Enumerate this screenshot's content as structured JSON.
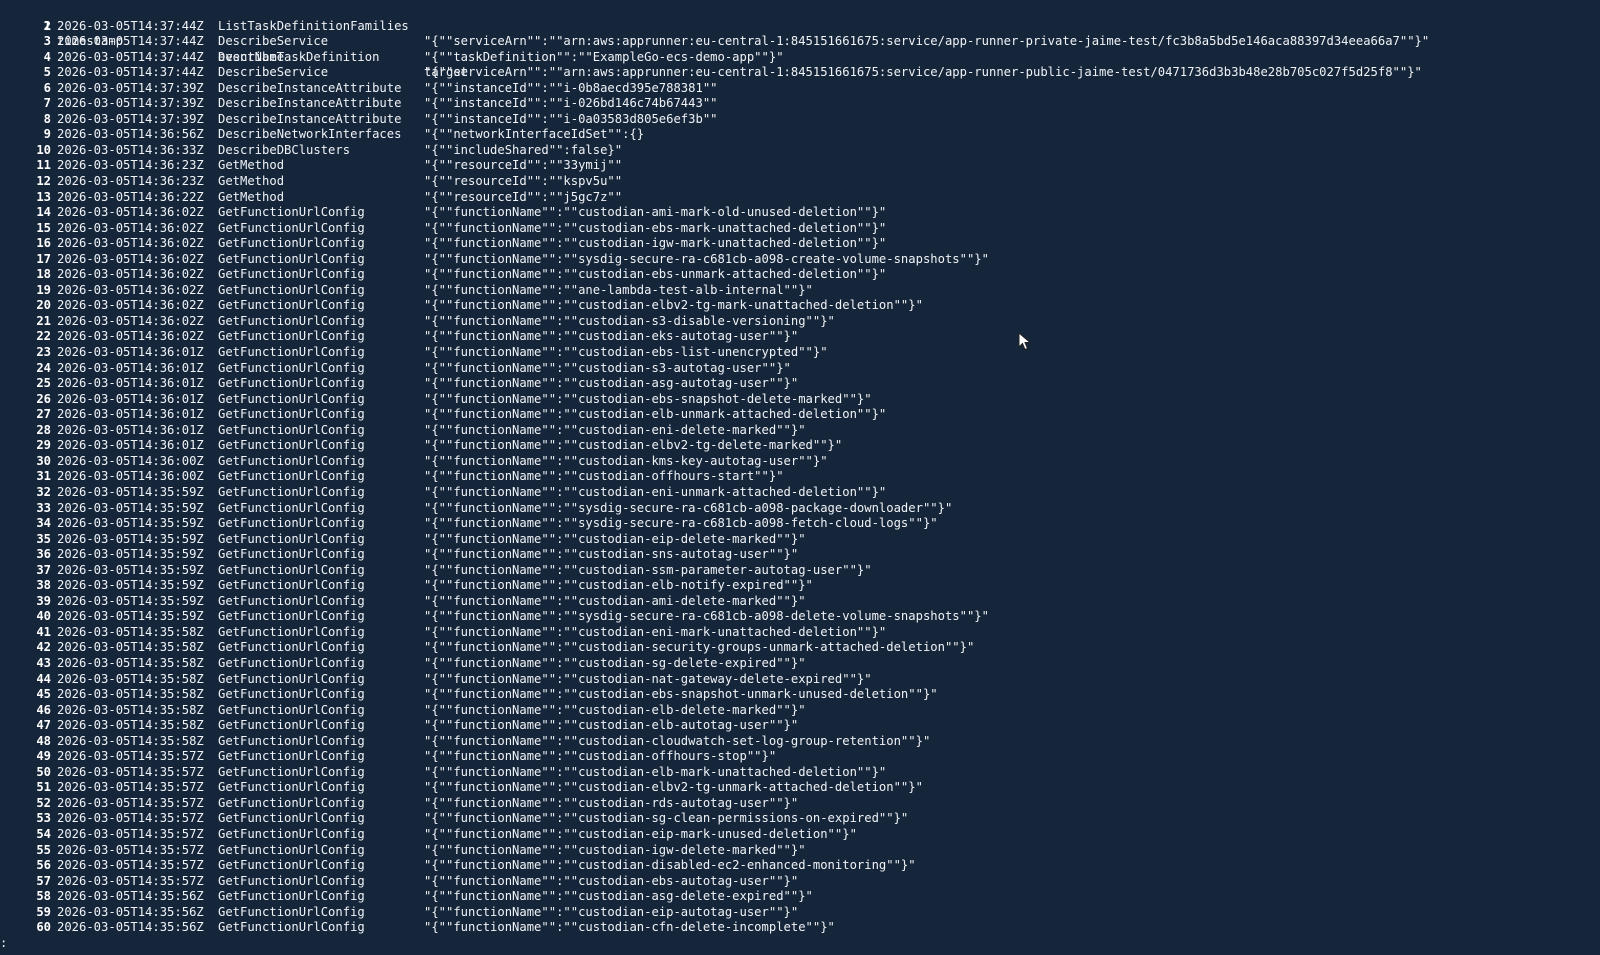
{
  "header": {
    "num": "1",
    "c1": "timestamp",
    "c2": "eventName",
    "c3": "target"
  },
  "rows": [
    {
      "num": "2",
      "ts": "2026-03-05T14:37:44Z",
      "ev": "ListTaskDefinitionFamilies",
      "tg": ""
    },
    {
      "num": "3",
      "ts": "2026-03-05T14:37:44Z",
      "ev": "DescribeService",
      "tg": "\"{\"\"serviceArn\"\":\"\"arn:aws:apprunner:eu-central-1:845151661675:service/app-runner-private-jaime-test/fc3b8a5bd5e146aca88397d34eea66a7\"\"}\""
    },
    {
      "num": "4",
      "ts": "2026-03-05T14:37:44Z",
      "ev": "DescribeTaskDefinition",
      "tg": "\"{\"\"taskDefinition\"\":\"\"ExampleGo-ecs-demo-app\"\"}\""
    },
    {
      "num": "5",
      "ts": "2026-03-05T14:37:44Z",
      "ev": "DescribeService",
      "tg": "\"{\"\"serviceArn\"\":\"\"arn:aws:apprunner:eu-central-1:845151661675:service/app-runner-public-jaime-test/0471736d3b3b48e28b705c027f5d25f8\"\"}\""
    },
    {
      "num": "6",
      "ts": "2026-03-05T14:37:39Z",
      "ev": "DescribeInstanceAttribute",
      "tg": "\"{\"\"instanceId\"\":\"\"i-0b8aecd395e788381\"\""
    },
    {
      "num": "7",
      "ts": "2026-03-05T14:37:39Z",
      "ev": "DescribeInstanceAttribute",
      "tg": "\"{\"\"instanceId\"\":\"\"i-026bd146c74b67443\"\""
    },
    {
      "num": "8",
      "ts": "2026-03-05T14:37:39Z",
      "ev": "DescribeInstanceAttribute",
      "tg": "\"{\"\"instanceId\"\":\"\"i-0a03583d805e6ef3b\"\""
    },
    {
      "num": "9",
      "ts": "2026-03-05T14:36:56Z",
      "ev": "DescribeNetworkInterfaces",
      "tg": "\"{\"\"networkInterfaceIdSet\"\":{}"
    },
    {
      "num": "10",
      "ts": "2026-03-05T14:36:33Z",
      "ev": "DescribeDBClusters",
      "tg": "\"{\"\"includeShared\"\":false}\""
    },
    {
      "num": "11",
      "ts": "2026-03-05T14:36:23Z",
      "ev": "GetMethod",
      "tg": "\"{\"\"resourceId\"\":\"\"33ymij\"\""
    },
    {
      "num": "12",
      "ts": "2026-03-05T14:36:23Z",
      "ev": "GetMethod",
      "tg": "\"{\"\"resourceId\"\":\"\"kspv5u\"\""
    },
    {
      "num": "13",
      "ts": "2026-03-05T14:36:22Z",
      "ev": "GetMethod",
      "tg": "\"{\"\"resourceId\"\":\"\"j5gc7z\"\""
    },
    {
      "num": "14",
      "ts": "2026-03-05T14:36:02Z",
      "ev": "GetFunctionUrlConfig",
      "tg": "\"{\"\"functionName\"\":\"\"custodian-ami-mark-old-unused-deletion\"\"}\""
    },
    {
      "num": "15",
      "ts": "2026-03-05T14:36:02Z",
      "ev": "GetFunctionUrlConfig",
      "tg": "\"{\"\"functionName\"\":\"\"custodian-ebs-mark-unattached-deletion\"\"}\""
    },
    {
      "num": "16",
      "ts": "2026-03-05T14:36:02Z",
      "ev": "GetFunctionUrlConfig",
      "tg": "\"{\"\"functionName\"\":\"\"custodian-igw-mark-unattached-deletion\"\"}\""
    },
    {
      "num": "17",
      "ts": "2026-03-05T14:36:02Z",
      "ev": "GetFunctionUrlConfig",
      "tg": "\"{\"\"functionName\"\":\"\"sysdig-secure-ra-c681cb-a098-create-volume-snapshots\"\"}\""
    },
    {
      "num": "18",
      "ts": "2026-03-05T14:36:02Z",
      "ev": "GetFunctionUrlConfig",
      "tg": "\"{\"\"functionName\"\":\"\"custodian-ebs-unmark-attached-deletion\"\"}\""
    },
    {
      "num": "19",
      "ts": "2026-03-05T14:36:02Z",
      "ev": "GetFunctionUrlConfig",
      "tg": "\"{\"\"functionName\"\":\"\"ane-lambda-test-alb-internal\"\"}\""
    },
    {
      "num": "20",
      "ts": "2026-03-05T14:36:02Z",
      "ev": "GetFunctionUrlConfig",
      "tg": "\"{\"\"functionName\"\":\"\"custodian-elbv2-tg-mark-unattached-deletion\"\"}\""
    },
    {
      "num": "21",
      "ts": "2026-03-05T14:36:02Z",
      "ev": "GetFunctionUrlConfig",
      "tg": "\"{\"\"functionName\"\":\"\"custodian-s3-disable-versioning\"\"}\""
    },
    {
      "num": "22",
      "ts": "2026-03-05T14:36:02Z",
      "ev": "GetFunctionUrlConfig",
      "tg": "\"{\"\"functionName\"\":\"\"custodian-eks-autotag-user\"\"}\""
    },
    {
      "num": "23",
      "ts": "2026-03-05T14:36:01Z",
      "ev": "GetFunctionUrlConfig",
      "tg": "\"{\"\"functionName\"\":\"\"custodian-ebs-list-unencrypted\"\"}\""
    },
    {
      "num": "24",
      "ts": "2026-03-05T14:36:01Z",
      "ev": "GetFunctionUrlConfig",
      "tg": "\"{\"\"functionName\"\":\"\"custodian-s3-autotag-user\"\"}\""
    },
    {
      "num": "25",
      "ts": "2026-03-05T14:36:01Z",
      "ev": "GetFunctionUrlConfig",
      "tg": "\"{\"\"functionName\"\":\"\"custodian-asg-autotag-user\"\"}\""
    },
    {
      "num": "26",
      "ts": "2026-03-05T14:36:01Z",
      "ev": "GetFunctionUrlConfig",
      "tg": "\"{\"\"functionName\"\":\"\"custodian-ebs-snapshot-delete-marked\"\"}\""
    },
    {
      "num": "27",
      "ts": "2026-03-05T14:36:01Z",
      "ev": "GetFunctionUrlConfig",
      "tg": "\"{\"\"functionName\"\":\"\"custodian-elb-unmark-attached-deletion\"\"}\""
    },
    {
      "num": "28",
      "ts": "2026-03-05T14:36:01Z",
      "ev": "GetFunctionUrlConfig",
      "tg": "\"{\"\"functionName\"\":\"\"custodian-eni-delete-marked\"\"}\""
    },
    {
      "num": "29",
      "ts": "2026-03-05T14:36:01Z",
      "ev": "GetFunctionUrlConfig",
      "tg": "\"{\"\"functionName\"\":\"\"custodian-elbv2-tg-delete-marked\"\"}\""
    },
    {
      "num": "30",
      "ts": "2026-03-05T14:36:00Z",
      "ev": "GetFunctionUrlConfig",
      "tg": "\"{\"\"functionName\"\":\"\"custodian-kms-key-autotag-user\"\"}\""
    },
    {
      "num": "31",
      "ts": "2026-03-05T14:36:00Z",
      "ev": "GetFunctionUrlConfig",
      "tg": "\"{\"\"functionName\"\":\"\"custodian-offhours-start\"\"}\""
    },
    {
      "num": "32",
      "ts": "2026-03-05T14:35:59Z",
      "ev": "GetFunctionUrlConfig",
      "tg": "\"{\"\"functionName\"\":\"\"custodian-eni-unmark-attached-deletion\"\"}\""
    },
    {
      "num": "33",
      "ts": "2026-03-05T14:35:59Z",
      "ev": "GetFunctionUrlConfig",
      "tg": "\"{\"\"functionName\"\":\"\"sysdig-secure-ra-c681cb-a098-package-downloader\"\"}\""
    },
    {
      "num": "34",
      "ts": "2026-03-05T14:35:59Z",
      "ev": "GetFunctionUrlConfig",
      "tg": "\"{\"\"functionName\"\":\"\"sysdig-secure-ra-c681cb-a098-fetch-cloud-logs\"\"}\""
    },
    {
      "num": "35",
      "ts": "2026-03-05T14:35:59Z",
      "ev": "GetFunctionUrlConfig",
      "tg": "\"{\"\"functionName\"\":\"\"custodian-eip-delete-marked\"\"}\""
    },
    {
      "num": "36",
      "ts": "2026-03-05T14:35:59Z",
      "ev": "GetFunctionUrlConfig",
      "tg": "\"{\"\"functionName\"\":\"\"custodian-sns-autotag-user\"\"}\""
    },
    {
      "num": "37",
      "ts": "2026-03-05T14:35:59Z",
      "ev": "GetFunctionUrlConfig",
      "tg": "\"{\"\"functionName\"\":\"\"custodian-ssm-parameter-autotag-user\"\"}\""
    },
    {
      "num": "38",
      "ts": "2026-03-05T14:35:59Z",
      "ev": "GetFunctionUrlConfig",
      "tg": "\"{\"\"functionName\"\":\"\"custodian-elb-notify-expired\"\"}\""
    },
    {
      "num": "39",
      "ts": "2026-03-05T14:35:59Z",
      "ev": "GetFunctionUrlConfig",
      "tg": "\"{\"\"functionName\"\":\"\"custodian-ami-delete-marked\"\"}\""
    },
    {
      "num": "40",
      "ts": "2026-03-05T14:35:59Z",
      "ev": "GetFunctionUrlConfig",
      "tg": "\"{\"\"functionName\"\":\"\"sysdig-secure-ra-c681cb-a098-delete-volume-snapshots\"\"}\""
    },
    {
      "num": "41",
      "ts": "2026-03-05T14:35:58Z",
      "ev": "GetFunctionUrlConfig",
      "tg": "\"{\"\"functionName\"\":\"\"custodian-eni-mark-unattached-deletion\"\"}\""
    },
    {
      "num": "42",
      "ts": "2026-03-05T14:35:58Z",
      "ev": "GetFunctionUrlConfig",
      "tg": "\"{\"\"functionName\"\":\"\"custodian-security-groups-unmark-attached-deletion\"\"}\""
    },
    {
      "num": "43",
      "ts": "2026-03-05T14:35:58Z",
      "ev": "GetFunctionUrlConfig",
      "tg": "\"{\"\"functionName\"\":\"\"custodian-sg-delete-expired\"\"}\""
    },
    {
      "num": "44",
      "ts": "2026-03-05T14:35:58Z",
      "ev": "GetFunctionUrlConfig",
      "tg": "\"{\"\"functionName\"\":\"\"custodian-nat-gateway-delete-expired\"\"}\""
    },
    {
      "num": "45",
      "ts": "2026-03-05T14:35:58Z",
      "ev": "GetFunctionUrlConfig",
      "tg": "\"{\"\"functionName\"\":\"\"custodian-ebs-snapshot-unmark-unused-deletion\"\"}\""
    },
    {
      "num": "46",
      "ts": "2026-03-05T14:35:58Z",
      "ev": "GetFunctionUrlConfig",
      "tg": "\"{\"\"functionName\"\":\"\"custodian-elb-delete-marked\"\"}\""
    },
    {
      "num": "47",
      "ts": "2026-03-05T14:35:58Z",
      "ev": "GetFunctionUrlConfig",
      "tg": "\"{\"\"functionName\"\":\"\"custodian-elb-autotag-user\"\"}\""
    },
    {
      "num": "48",
      "ts": "2026-03-05T14:35:58Z",
      "ev": "GetFunctionUrlConfig",
      "tg": "\"{\"\"functionName\"\":\"\"custodian-cloudwatch-set-log-group-retention\"\"}\""
    },
    {
      "num": "49",
      "ts": "2026-03-05T14:35:57Z",
      "ev": "GetFunctionUrlConfig",
      "tg": "\"{\"\"functionName\"\":\"\"custodian-offhours-stop\"\"}\""
    },
    {
      "num": "50",
      "ts": "2026-03-05T14:35:57Z",
      "ev": "GetFunctionUrlConfig",
      "tg": "\"{\"\"functionName\"\":\"\"custodian-elb-mark-unattached-deletion\"\"}\""
    },
    {
      "num": "51",
      "ts": "2026-03-05T14:35:57Z",
      "ev": "GetFunctionUrlConfig",
      "tg": "\"{\"\"functionName\"\":\"\"custodian-elbv2-tg-unmark-attached-deletion\"\"}\""
    },
    {
      "num": "52",
      "ts": "2026-03-05T14:35:57Z",
      "ev": "GetFunctionUrlConfig",
      "tg": "\"{\"\"functionName\"\":\"\"custodian-rds-autotag-user\"\"}\""
    },
    {
      "num": "53",
      "ts": "2026-03-05T14:35:57Z",
      "ev": "GetFunctionUrlConfig",
      "tg": "\"{\"\"functionName\"\":\"\"custodian-sg-clean-permissions-on-expired\"\"}\""
    },
    {
      "num": "54",
      "ts": "2026-03-05T14:35:57Z",
      "ev": "GetFunctionUrlConfig",
      "tg": "\"{\"\"functionName\"\":\"\"custodian-eip-mark-unused-deletion\"\"}\""
    },
    {
      "num": "55",
      "ts": "2026-03-05T14:35:57Z",
      "ev": "GetFunctionUrlConfig",
      "tg": "\"{\"\"functionName\"\":\"\"custodian-igw-delete-marked\"\"}\""
    },
    {
      "num": "56",
      "ts": "2026-03-05T14:35:57Z",
      "ev": "GetFunctionUrlConfig",
      "tg": "\"{\"\"functionName\"\":\"\"custodian-disabled-ec2-enhanced-monitoring\"\"}\""
    },
    {
      "num": "57",
      "ts": "2026-03-05T14:35:57Z",
      "ev": "GetFunctionUrlConfig",
      "tg": "\"{\"\"functionName\"\":\"\"custodian-ebs-autotag-user\"\"}\""
    },
    {
      "num": "58",
      "ts": "2026-03-05T14:35:56Z",
      "ev": "GetFunctionUrlConfig",
      "tg": "\"{\"\"functionName\"\":\"\"custodian-asg-delete-expired\"\"}\""
    },
    {
      "num": "59",
      "ts": "2026-03-05T14:35:56Z",
      "ev": "GetFunctionUrlConfig",
      "tg": "\"{\"\"functionName\"\":\"\"custodian-eip-autotag-user\"\"}\""
    },
    {
      "num": "60",
      "ts": "2026-03-05T14:35:56Z",
      "ev": "GetFunctionUrlConfig",
      "tg": "\"{\"\"functionName\"\":\"\"custodian-cfn-delete-incomplete\"\"}\""
    }
  ],
  "prompt": ":",
  "colors": {
    "background": "#16263a",
    "text": "#e8edf3"
  },
  "icons": {
    "cursor": "mouse-pointer-icon"
  }
}
